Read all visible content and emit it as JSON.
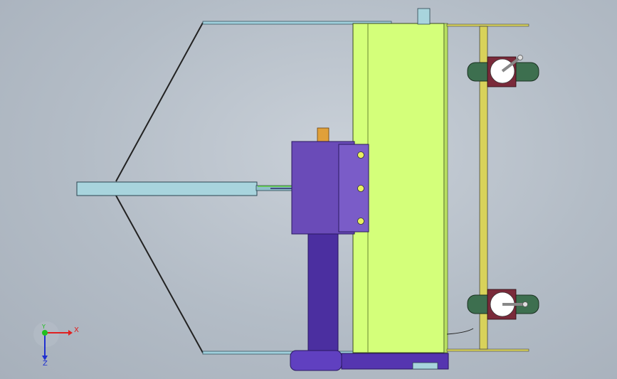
{
  "viewport": {
    "background_top": "#c9d0d8",
    "background_bottom": "#a7b0bb"
  },
  "model": {
    "colors": {
      "frame": "#d4ff7a",
      "frame_dark": "#b8e060",
      "gearbox": "#6a4bb8",
      "gearbox_dark": "#4f3599",
      "shaft": "#a8d4dd",
      "lift_cylinder": "#4b2fa0",
      "wheel": "#3d6f4f",
      "wheel_bracket": "#7a2a3a",
      "axle_bar": "#d8d25a",
      "input_stub": "#e0a03a"
    }
  },
  "triad": {
    "x_label": "X",
    "y_label": "Y",
    "z_label": "Z",
    "x_color": "#e02020",
    "y_color": "#20c020",
    "z_color": "#2030d0"
  }
}
